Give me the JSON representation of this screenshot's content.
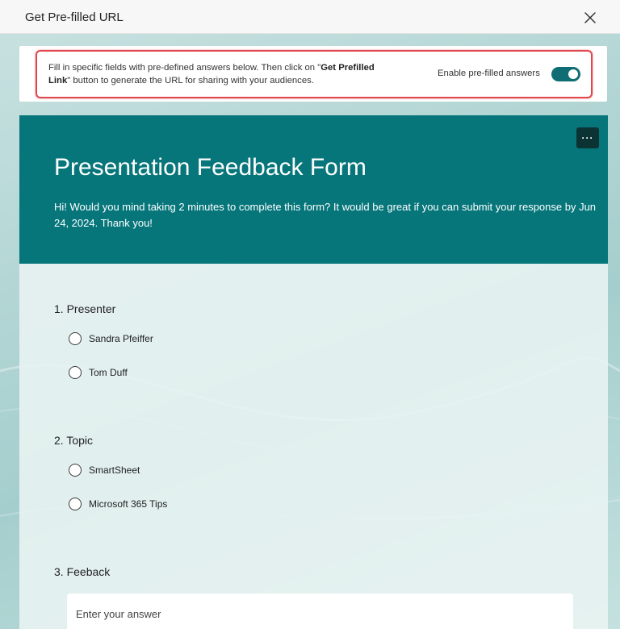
{
  "dialog": {
    "title": "Get Pre-filled URL"
  },
  "banner": {
    "text_before": "Fill in specific fields with pre-defined answers below. Then click on \"",
    "bold": "Get Prefilled Link",
    "text_after": "\" button to generate the URL for sharing with your audiences.",
    "toggle_label": "Enable pre-filled answers",
    "toggle_on": true
  },
  "form": {
    "more_label": "···",
    "title": "Presentation Feedback Form",
    "description": "Hi! Would you mind taking 2 minutes to complete this form? It would be great if you can submit your response by Jun 24, 2024. Thank you!",
    "questions": [
      {
        "label": "1. Presenter",
        "options": [
          "Sandra Pfeiffer",
          "Tom Duff"
        ]
      },
      {
        "label": "2. Topic",
        "options": [
          "SmartSheet",
          "Microsoft 365 Tips"
        ]
      },
      {
        "label": "3. Feeback",
        "placeholder": "Enter your answer"
      }
    ]
  },
  "colors": {
    "accent": "#06767b",
    "toggle": "#0e6e73",
    "highlight": "#e0474c"
  },
  "icons": {
    "close": "close-icon",
    "more": "more-icon"
  }
}
